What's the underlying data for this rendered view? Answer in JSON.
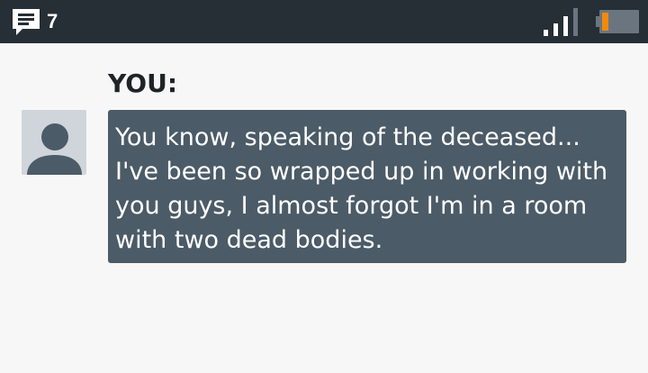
{
  "status_bar": {
    "message_icon": "chat-bubble-icon",
    "message_count": "7",
    "signal_icon": "signal-strength-icon",
    "battery_icon": "battery-low-icon",
    "background_color": "#262e36",
    "battery_level_color": "#f28a0a"
  },
  "conversation": {
    "speaker": "YOU:",
    "avatar_icon": "user-avatar-icon",
    "message": "You know, speaking of the deceased... I've been so wrapped up in working with you guys, I almost forgot I'm in a room with two dead bodies.",
    "bubble_color": "#4b5b67"
  }
}
